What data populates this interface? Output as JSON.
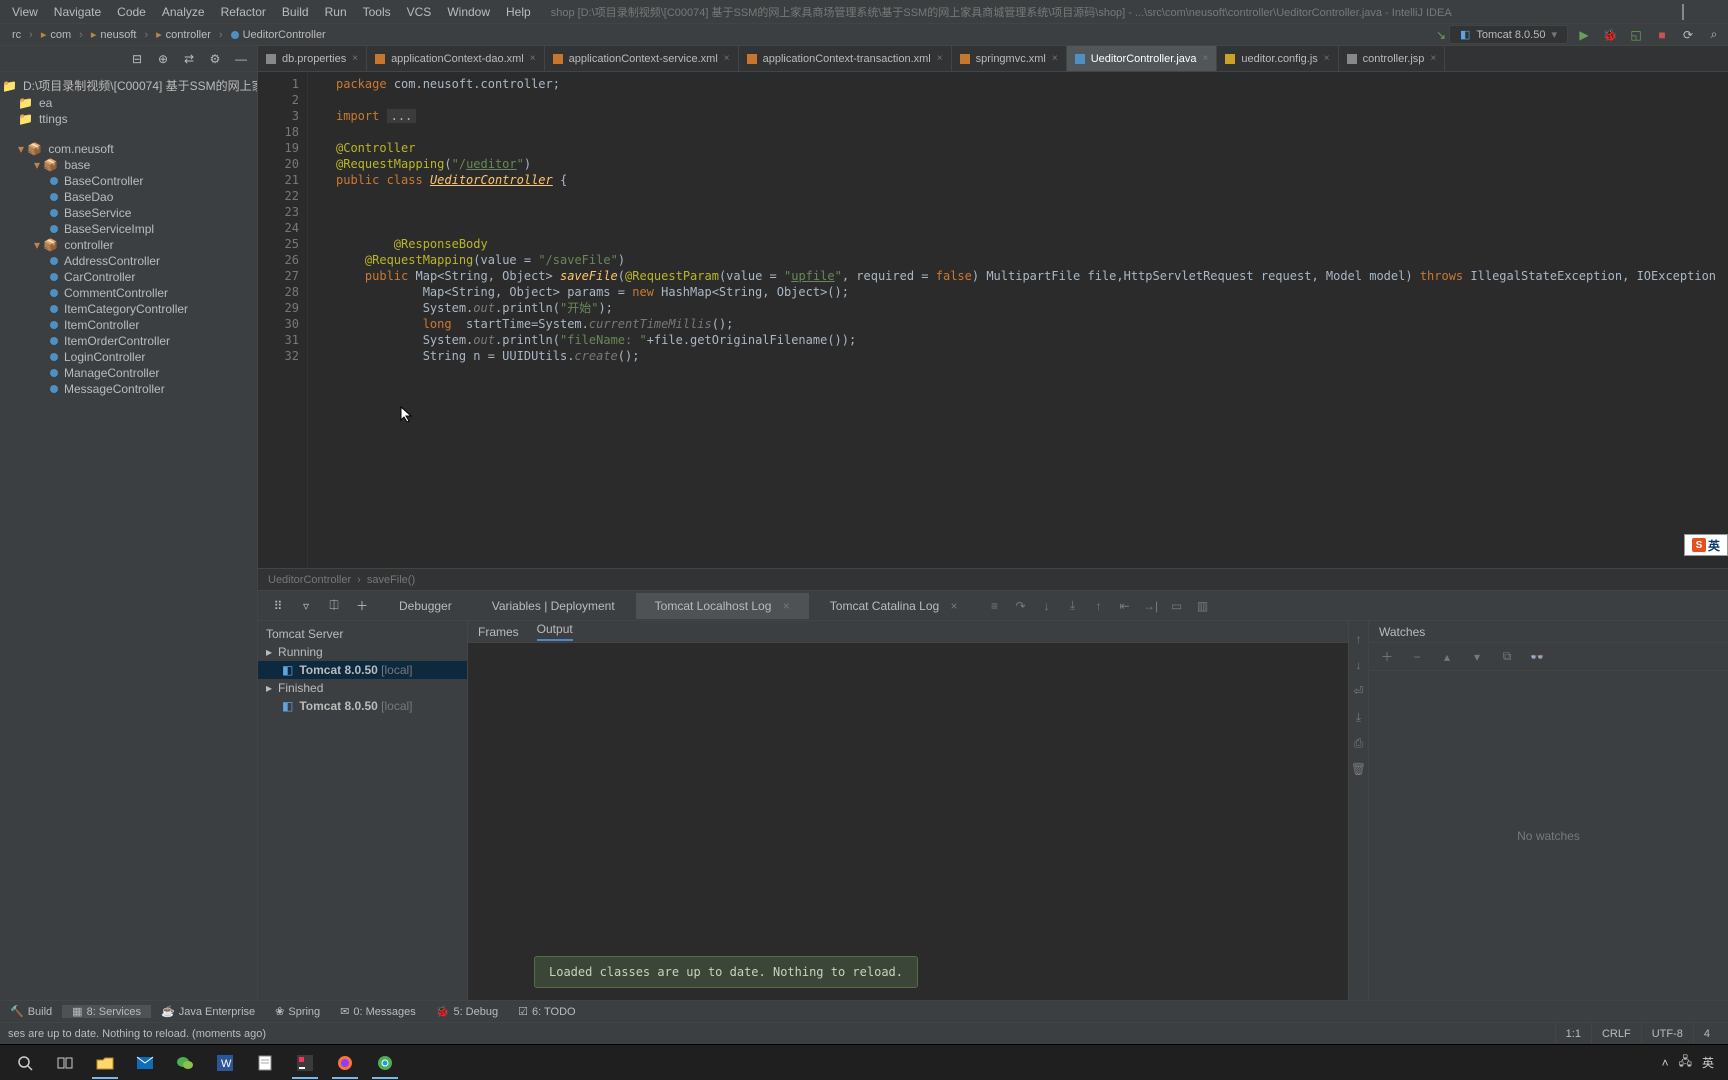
{
  "menu": {
    "items": [
      "View",
      "Navigate",
      "Code",
      "Analyze",
      "Refactor",
      "Build",
      "Run",
      "Tools",
      "VCS",
      "Window",
      "Help"
    ]
  },
  "title": "shop [D:\\项目录制视频\\[C00074] 基于SSM的网上家具商场管理系统\\基于SSM的网上家具商城管理系统\\项目源码\\shop] - ...\\src\\com\\neusoft\\controller\\UeditorController.java - IntelliJ IDEA",
  "breadcrumbs": [
    "rc",
    "com",
    "neusoft",
    "controller",
    "UeditorController"
  ],
  "run_config": {
    "label": "Tomcat 8.0.50"
  },
  "project": {
    "root": "D:\\项目录制视频\\[C00074] 基于SSM的网上家具商",
    "items": [
      {
        "label": "ea",
        "indent": 1,
        "icon": "folder"
      },
      {
        "label": "ttings",
        "indent": 1,
        "icon": "folder"
      },
      {
        "label": "",
        "indent": 1,
        "gap": true
      },
      {
        "label": "com.neusoft",
        "indent": 1,
        "icon": "pkg"
      },
      {
        "label": "base",
        "indent": 2,
        "icon": "pkg",
        "expanded": true
      },
      {
        "label": "BaseController",
        "indent": 3,
        "icon": "class"
      },
      {
        "label": "BaseDao",
        "indent": 3,
        "icon": "class"
      },
      {
        "label": "BaseService",
        "indent": 3,
        "icon": "class"
      },
      {
        "label": "BaseServiceImpl",
        "indent": 3,
        "icon": "class"
      },
      {
        "label": "controller",
        "indent": 2,
        "icon": "pkg",
        "expanded": true
      },
      {
        "label": "AddressController",
        "indent": 3,
        "icon": "class"
      },
      {
        "label": "CarController",
        "indent": 3,
        "icon": "class"
      },
      {
        "label": "CommentController",
        "indent": 3,
        "icon": "class"
      },
      {
        "label": "ItemCategoryController",
        "indent": 3,
        "icon": "class"
      },
      {
        "label": "ItemController",
        "indent": 3,
        "icon": "class"
      },
      {
        "label": "ItemOrderController",
        "indent": 3,
        "icon": "class"
      },
      {
        "label": "LoginController",
        "indent": 3,
        "icon": "class"
      },
      {
        "label": "ManageController",
        "indent": 3,
        "icon": "class"
      },
      {
        "label": "MessageController",
        "indent": 3,
        "icon": "class"
      }
    ]
  },
  "tabs": [
    {
      "label": "db.properties",
      "icon": "props"
    },
    {
      "label": "applicationContext-dao.xml",
      "icon": "xml"
    },
    {
      "label": "applicationContext-service.xml",
      "icon": "xml"
    },
    {
      "label": "applicationContext-transaction.xml",
      "icon": "xml"
    },
    {
      "label": "springmvc.xml",
      "icon": "xml"
    },
    {
      "label": "UeditorController.java",
      "icon": "java",
      "active": true
    },
    {
      "label": "ueditor.config.js",
      "icon": "js"
    },
    {
      "label": "controller.jsp",
      "icon": "jsp"
    }
  ],
  "gutter": [
    "1",
    "2",
    "3",
    "18",
    "19",
    "20",
    "21",
    "22",
    "23",
    "24",
    "25",
    "26",
    "27",
    "28",
    "29",
    "30",
    "31",
    "32"
  ],
  "bottom_crumb": {
    "cls": "UeditorController",
    "method": "saveFile()"
  },
  "debug": {
    "tabs": [
      "Debugger",
      "Variables | Deployment",
      "Tomcat Localhost Log",
      "Tomcat Catalina Log"
    ],
    "active_tab": 2,
    "serverHead": "Tomcat Server",
    "tree": [
      {
        "label": "Running",
        "kind": "head"
      },
      {
        "label": "Tomcat 8.0.50",
        "suffix": "[local]",
        "kind": "item",
        "sel": true
      },
      {
        "label": "Finished",
        "kind": "head"
      },
      {
        "label": "Tomcat 8.0.50",
        "suffix": "[local]",
        "kind": "item"
      }
    ],
    "subtabs": [
      "Frames",
      "Output"
    ],
    "sub_active": 1,
    "watches_title": "Watches",
    "no_watches": "No watches",
    "popup": "Loaded classes are up to date. Nothing to reload."
  },
  "bottom_tabs": [
    {
      "label": "Build",
      "num": ""
    },
    {
      "label": "8: Services",
      "active": true
    },
    {
      "label": "Java Enterprise"
    },
    {
      "label": "Spring"
    },
    {
      "label": "0: Messages"
    },
    {
      "label": "5: Debug"
    },
    {
      "label": "6: TODO"
    }
  ],
  "status": {
    "msg": "ses are up to date. Nothing to reload. (moments ago)",
    "pos": "1:1",
    "eol": "CRLF",
    "enc": "UTF-8",
    "indent": "4"
  },
  "tray": {
    "ime": "英"
  }
}
